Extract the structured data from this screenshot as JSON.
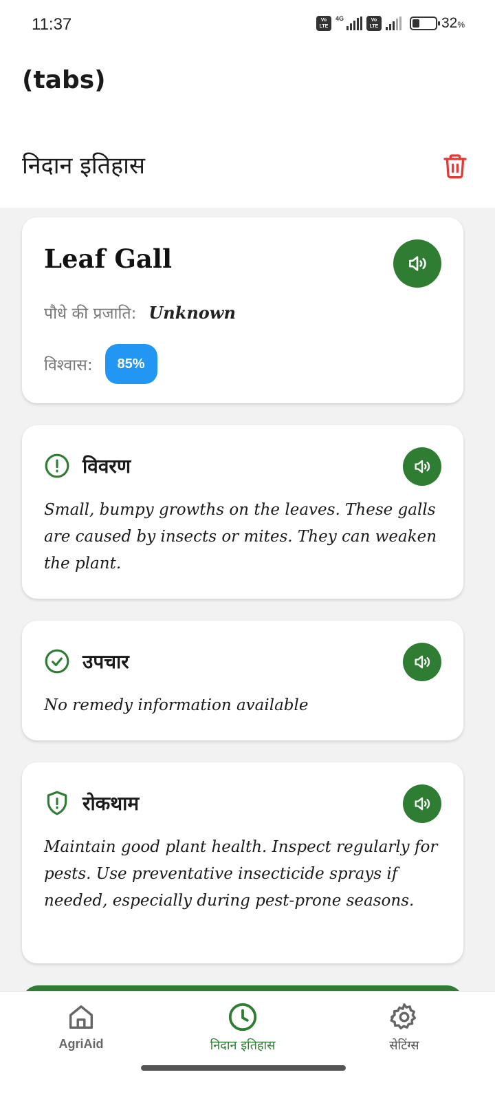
{
  "status_bar": {
    "time": "11:37",
    "network": "4G",
    "volte_label": "Vo LTE",
    "battery_percent": "32",
    "battery_unit": "%",
    "battery_level": 0.32
  },
  "app": {
    "tabs_title": "(tabs)"
  },
  "header": {
    "title": "निदान इतिहास",
    "delete_icon": "trash-icon",
    "delete_color": "#e53935"
  },
  "diagnosis": {
    "disease_name": "Leaf Gall",
    "species_label": "पौधे की प्रजाति:",
    "species_value": "Unknown",
    "confidence_label": "विश्वास:",
    "confidence_value": "85%"
  },
  "sections": {
    "description": {
      "title": "विवरण",
      "icon": "alert-circle-icon",
      "text": "Small, bumpy growths on the leaves.  These galls are caused by insects or mites. They can weaken the plant."
    },
    "treatment": {
      "title": "उपचार",
      "icon": "check-circle-icon",
      "text": "No remedy information available"
    },
    "prevention": {
      "title": "रोकथाम",
      "icon": "shield-alert-icon",
      "text": "Maintain good plant health.  Inspect regularly for pests.  Use preventative insecticide sprays if needed, especially during pest-prone seasons."
    }
  },
  "bottom_nav": {
    "items": [
      {
        "label": "AgriAid",
        "icon": "home-icon"
      },
      {
        "label": "निदान इतिहास",
        "icon": "clock-icon",
        "active": true
      },
      {
        "label": "सेटिंग्स",
        "icon": "gear-icon"
      }
    ]
  },
  "colors": {
    "primary": "#2e7d32",
    "badge": "#2196f3",
    "danger": "#e53935",
    "background": "#f2f2f2"
  }
}
